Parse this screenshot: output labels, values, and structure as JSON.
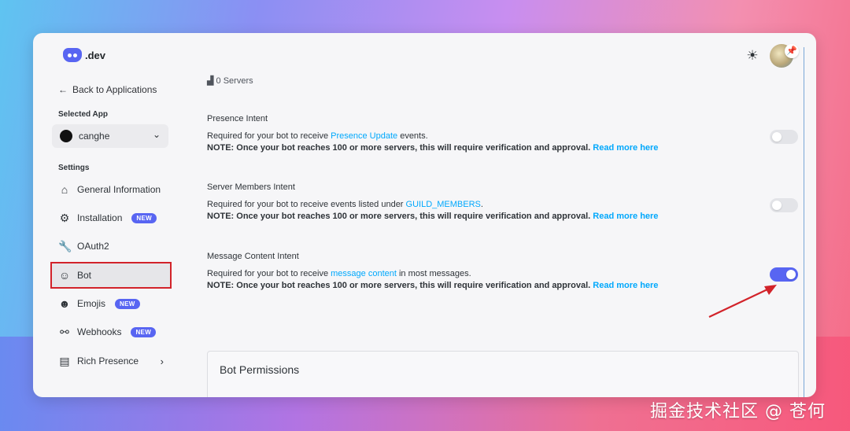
{
  "header": {
    "logo_text": ".dev"
  },
  "sidebar": {
    "back_label": "Back to Applications",
    "selected_app_heading": "Selected App",
    "selected_app_name": "canghe",
    "settings_heading": "Settings",
    "items": [
      {
        "label": "General Information",
        "icon": "home-icon"
      },
      {
        "label": "Installation",
        "icon": "gear-icon",
        "badge": "NEW"
      },
      {
        "label": "OAuth2",
        "icon": "wrench-icon"
      },
      {
        "label": "Bot",
        "icon": "bot-icon",
        "active": true
      },
      {
        "label": "Emojis",
        "icon": "smile-icon",
        "badge": "NEW"
      },
      {
        "label": "Webhooks",
        "icon": "webhook-icon",
        "badge": "NEW"
      },
      {
        "label": "Rich Presence",
        "icon": "document-icon",
        "has_submenu": true
      }
    ]
  },
  "main": {
    "servers_count": "0 Servers",
    "intents": [
      {
        "title": "Presence Intent",
        "desc_prefix": "Required for your bot to receive ",
        "desc_link": "Presence Update",
        "desc_suffix": " events.",
        "note": "NOTE: Once your bot reaches 100 or more servers, this will require verification and approval.",
        "read_more": "Read more here",
        "enabled": false
      },
      {
        "title": "Server Members Intent",
        "desc_prefix": "Required for your bot to receive events listed under ",
        "desc_link": "GUILD_MEMBERS",
        "desc_suffix": ".",
        "note": "NOTE: Once your bot reaches 100 or more servers, this will require verification and approval.",
        "read_more": "Read more here",
        "enabled": false
      },
      {
        "title": "Message Content Intent",
        "desc_prefix": "Required for your bot to receive ",
        "desc_link": "message content",
        "desc_suffix": " in most messages.",
        "note": "NOTE: Once your bot reaches 100 or more servers, this will require verification and approval.",
        "read_more": "Read more here",
        "enabled": true
      }
    ],
    "bot_permissions_title": "Bot Permissions"
  },
  "watermark": "掘金技术社区 @ 苍何",
  "colors": {
    "accent": "#5865f2",
    "link": "#00a8fc",
    "highlight": "#d2232a"
  }
}
